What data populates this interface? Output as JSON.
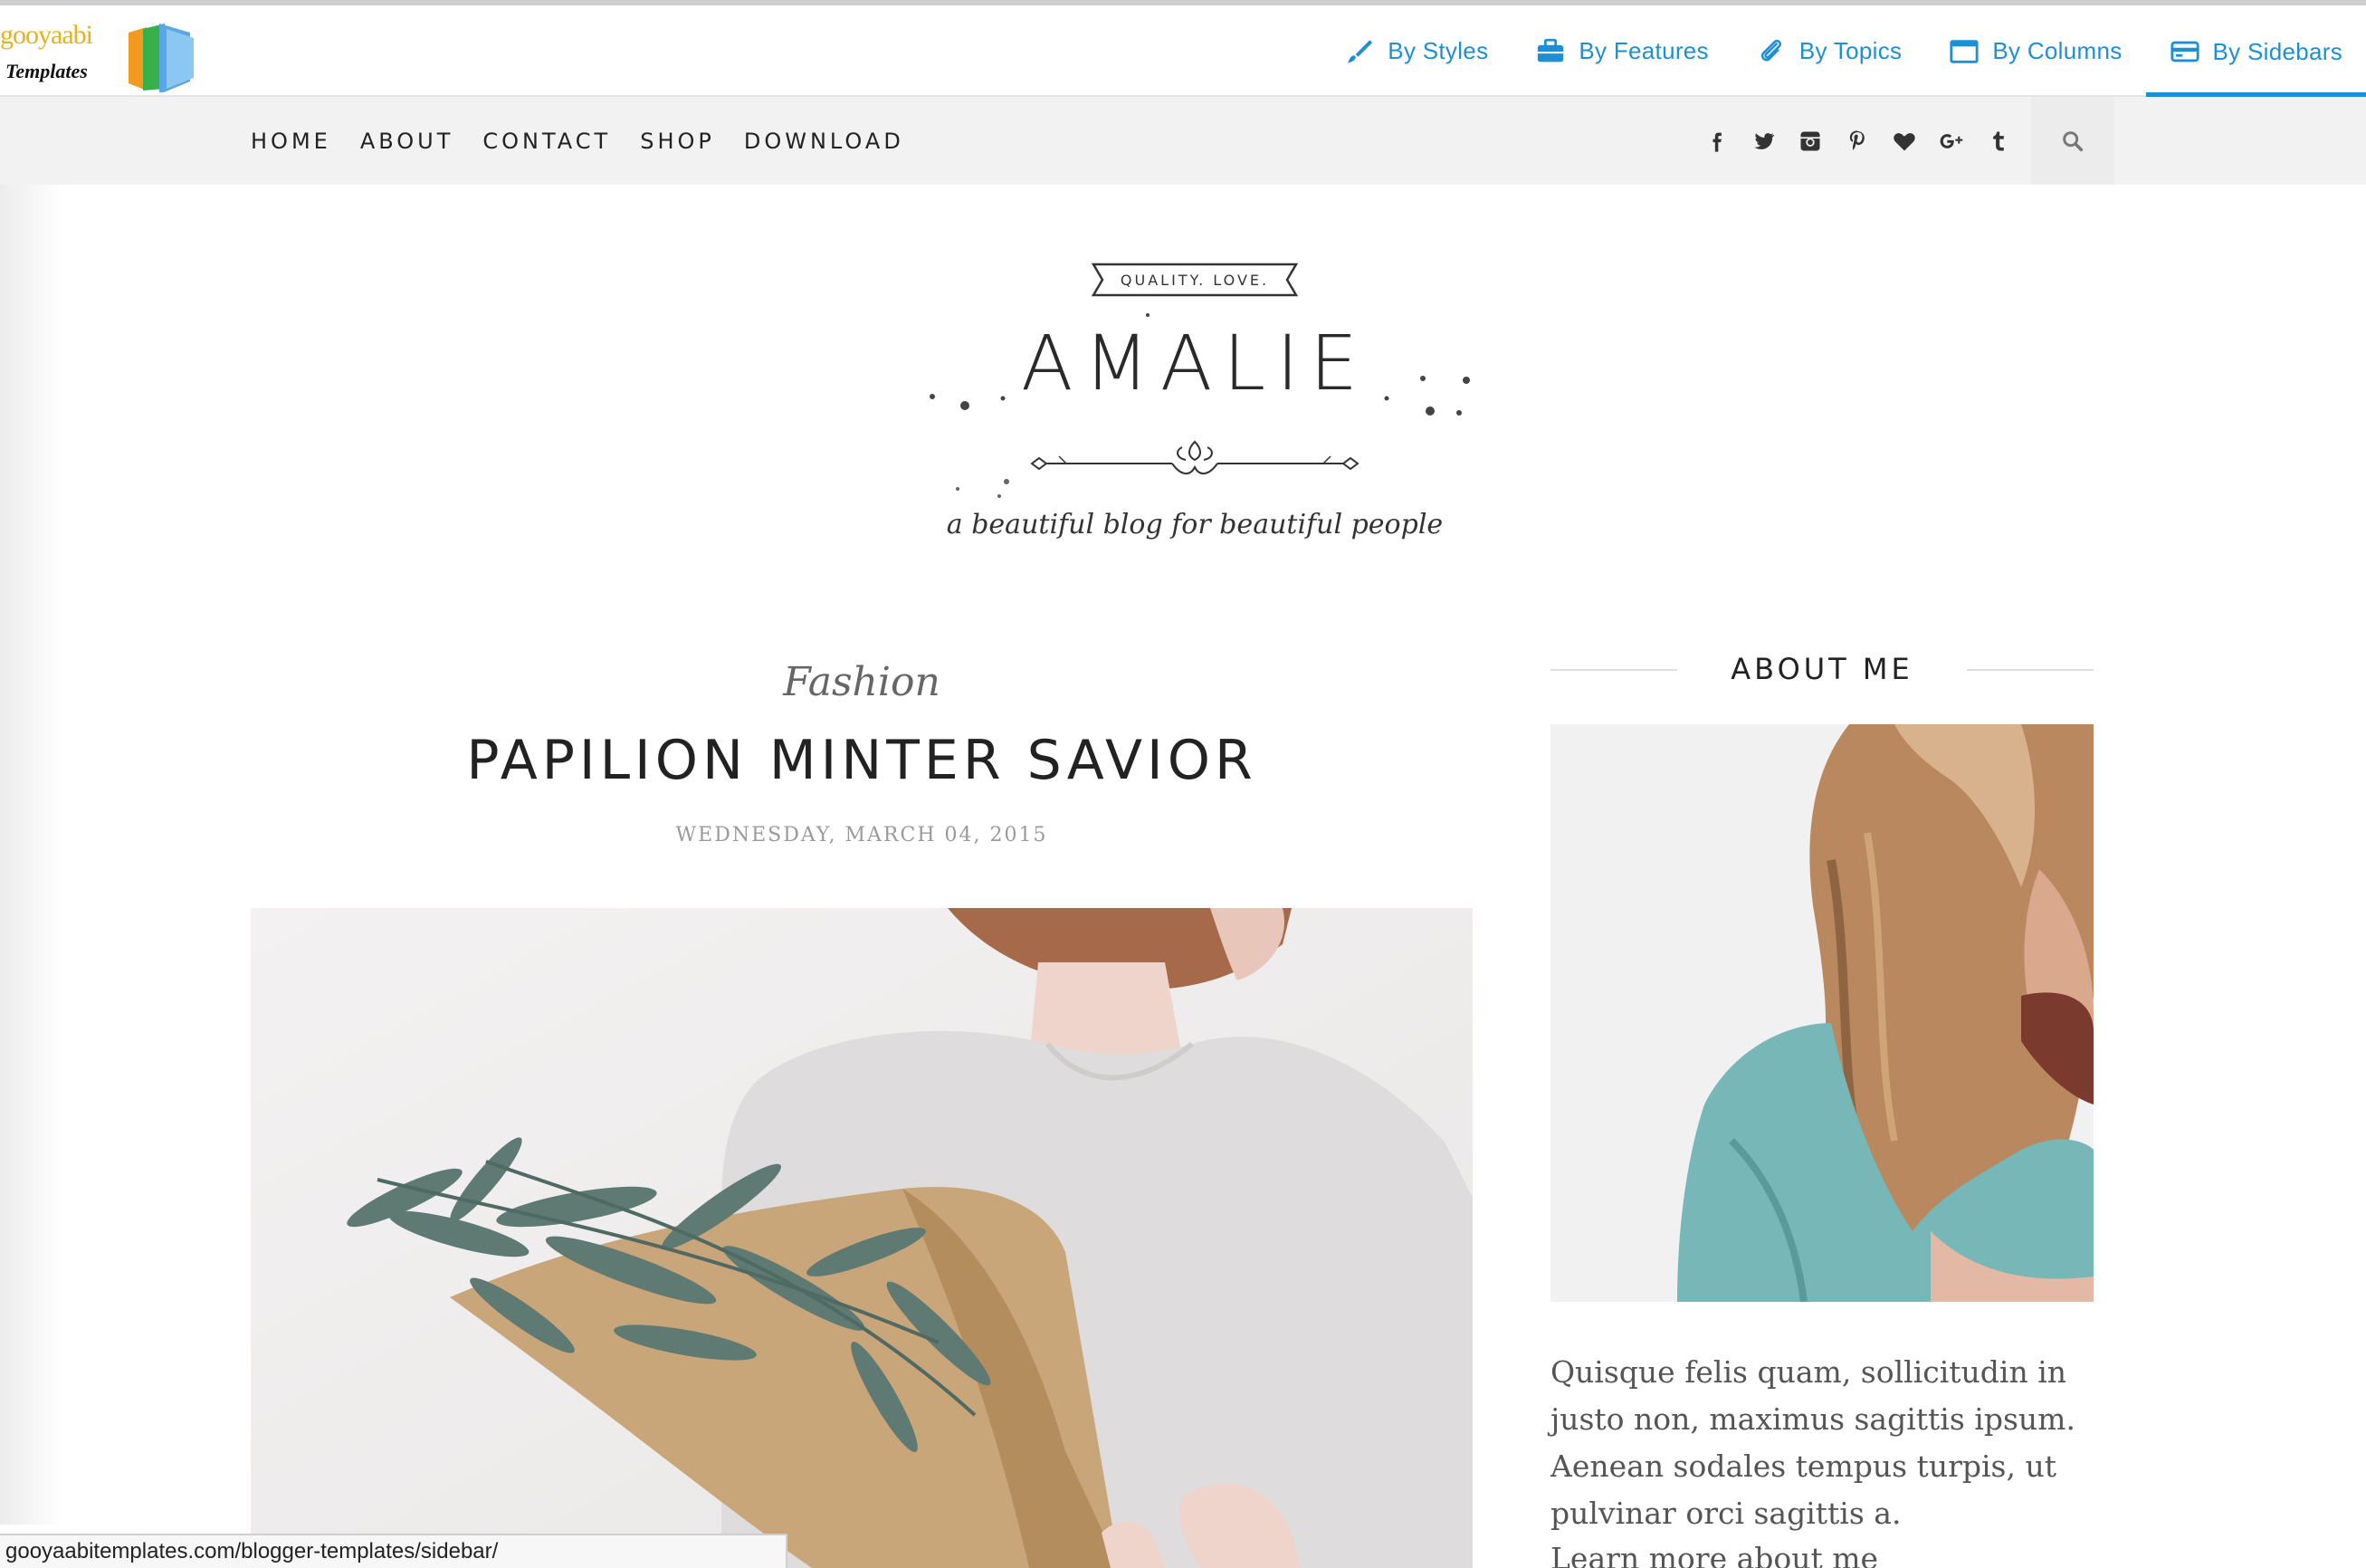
{
  "gooyaabi": {
    "brand_top": "gooyaabi",
    "brand_bottom": "Templates",
    "nav": [
      {
        "label": "By Styles",
        "icon": "brush-icon"
      },
      {
        "label": "By Features",
        "icon": "briefcase-icon"
      },
      {
        "label": "By Topics",
        "icon": "paperclip-icon"
      },
      {
        "label": "By Columns",
        "icon": "window-icon"
      },
      {
        "label": "By Sidebars",
        "icon": "credit-card-icon"
      }
    ],
    "accent": "#1e8fd5"
  },
  "menu": {
    "items": [
      "HOME",
      "ABOUT",
      "CONTACT",
      "SHOP",
      "DOWNLOAD"
    ],
    "social_icons": [
      "facebook-icon",
      "twitter-icon",
      "instagram-icon",
      "pinterest-icon",
      "heart-icon",
      "google-plus-icon",
      "tumblr-icon"
    ]
  },
  "header": {
    "ribbon": "QUALITY. LOVE.",
    "title": "AMALIE",
    "tagline": "a beautiful blog for beautiful people"
  },
  "post": {
    "category": "Fashion",
    "title": "PAPILION MINTER SAVIOR",
    "date": "WEDNESDAY, MARCH 04, 2015"
  },
  "sidebar": {
    "about_heading": "ABOUT ME",
    "about_text": "Quisque felis quam, sollicitudin in justo non, maximus sagittis ipsum. Aenean sodales tempus turpis, ut pulvinar orci sagittis a.",
    "learn_more": "Learn more about me"
  },
  "status": {
    "url": "gooyaabitemplates.com/blogger-templates/sidebar/"
  }
}
